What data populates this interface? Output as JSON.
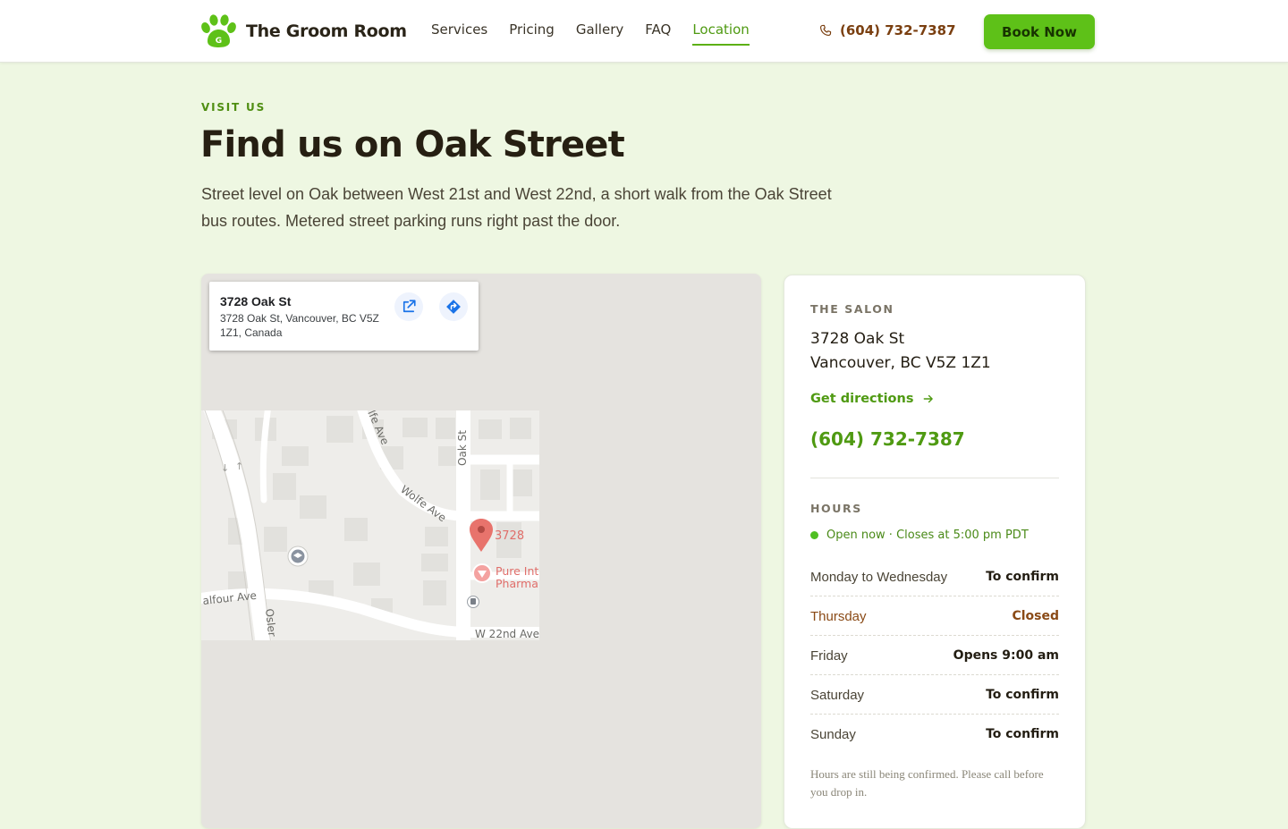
{
  "header": {
    "brand": "The Groom Room",
    "logo_letter": "G",
    "nav": [
      {
        "label": "Services",
        "active": false
      },
      {
        "label": "Pricing",
        "active": false
      },
      {
        "label": "Gallery",
        "active": false
      },
      {
        "label": "FAQ",
        "active": false
      },
      {
        "label": "Location",
        "active": true
      }
    ],
    "phone": "(604) 732-7387",
    "cta_label": "Book Now"
  },
  "intro": {
    "eyebrow": "VISIT US",
    "title": "Find us on Oak Street",
    "lead": "Street level on Oak between West 21st and West 22nd, a short walk from the Oak Street bus routes. Metered street parking runs right past the door."
  },
  "map": {
    "card_title": "3728 Oak St",
    "card_address": "3728 Oak St, Vancouver, BC V5Z 1Z1, Canada",
    "labels": {
      "oak_st": "Oak St",
      "wolfe_ave_top": "lfe Ave",
      "wolfe_ave": "Wolfe Ave",
      "balfour_ave": "alfour Ave",
      "osler": "Osler",
      "w_22nd": "W 22nd Ave",
      "pin_label": "3728",
      "poi_line1": "Pure Int",
      "poi_line2": "Pharma"
    },
    "icons": [
      "open-in-new-icon",
      "directions-icon",
      "map-pin-icon",
      "school-icon",
      "pharmacy-icon",
      "transit-icon"
    ]
  },
  "info": {
    "salon_label": "THE SALON",
    "address_line1": "3728 Oak St",
    "address_line2": "Vancouver, BC V5Z 1Z1",
    "directions_label": "Get directions",
    "phone": "(604) 732-7387",
    "hours_label": "HOURS",
    "open_status": "Open now · Closes at 5:00 pm PDT",
    "hours": [
      {
        "day": "Monday to Wednesday",
        "time": "To confirm",
        "closed": false
      },
      {
        "day": "Thursday",
        "time": "Closed",
        "closed": true
      },
      {
        "day": "Friday",
        "time": "Opens 9:00 am",
        "closed": false
      },
      {
        "day": "Saturday",
        "time": "To confirm",
        "closed": false
      },
      {
        "day": "Sunday",
        "time": "To confirm",
        "closed": false
      }
    ],
    "note": "Hours are still being confirmed. Please call before you drop in."
  },
  "colors": {
    "accent": "#5ec118",
    "accent_text": "#4f9a12",
    "phone_brown": "#7a3f10",
    "page_bg": "#eef7e2",
    "open_dot": "#4fbf22",
    "closed_text": "#8a4a16"
  }
}
